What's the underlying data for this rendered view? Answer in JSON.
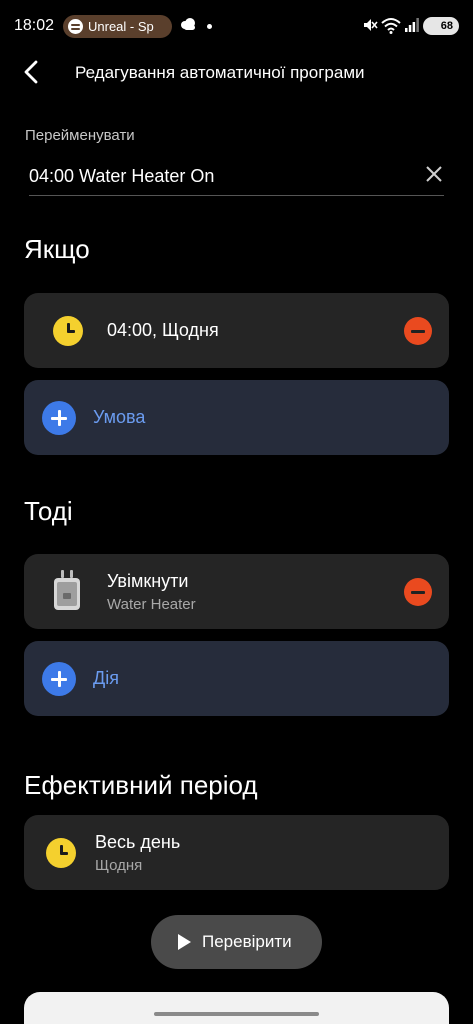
{
  "status_bar": {
    "time": "18:02",
    "media_label": "Unreal - Sp",
    "battery": "68"
  },
  "header": {
    "title": "Редагування автоматичної програми"
  },
  "rename": {
    "label": "Перейменувати",
    "value": "04:00 Water Heater On"
  },
  "if_section": {
    "title": "Якщо",
    "condition": {
      "text": "04:00, Щодня"
    },
    "add_label": "Умова"
  },
  "then_section": {
    "title": "Тоді",
    "action": {
      "title": "Увімкнути",
      "device": "Water Heater"
    },
    "add_label": "Дія"
  },
  "effective_period": {
    "title": "Ефективний період",
    "value": "Весь день",
    "sub": "Щодня"
  },
  "test_button": {
    "label": "Перевірити"
  },
  "colors": {
    "background": "#000000",
    "card": "#252525",
    "add_card": "#262c3b",
    "accent_blue": "#3d7ae8",
    "add_label_blue": "#6b9cf0",
    "remove_red": "#ea4a1f",
    "clock_yellow": "#f4d02e"
  },
  "icons": {
    "back": "chevron-left-icon",
    "clear": "close-icon",
    "schedule": "clock-icon",
    "remove": "minus-circle-icon",
    "add": "plus-circle-icon",
    "device": "smart-plug-icon",
    "test": "play-icon"
  }
}
